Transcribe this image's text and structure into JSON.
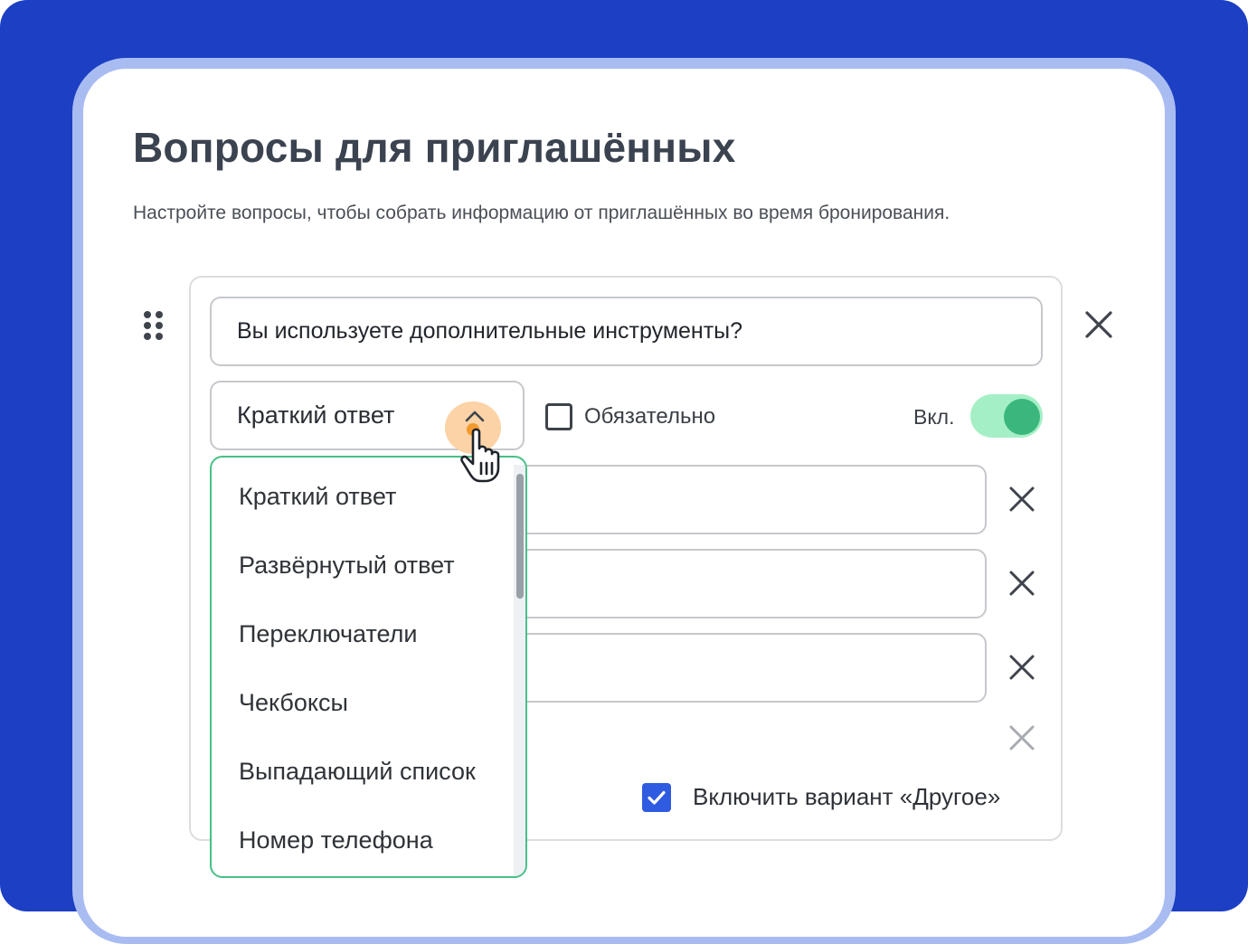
{
  "header": {
    "title": "Вопросы для приглашённых",
    "subtitle": "Настройте вопросы, чтобы собрать информацию от приглашённых во время бронирования."
  },
  "question": {
    "text": "Вы используете дополнительные инструменты?",
    "type_selected": "Краткий ответ",
    "required_label": "Обязательно",
    "required_checked": false,
    "toggle_label": "Вкл.",
    "toggle_on": true,
    "include_other_label": "Включить вариант «Другое»",
    "include_other_checked": true
  },
  "dropdown": {
    "options": [
      "Краткий ответ",
      "Развёрнутый ответ",
      "Переключатели",
      "Чекбоксы",
      "Выпадающий список",
      "Номер телефона"
    ]
  },
  "icons": {
    "drag": "drag-handle-icon",
    "close": "close-icon",
    "chevron": "chevron-up-icon",
    "cursor": "hand-pointer-icon",
    "check": "checkmark-icon"
  },
  "colors": {
    "background": "#1c3fc4",
    "accent_green": "#3bb77e",
    "toggle_track": "#a5efc7",
    "checkbox_blue": "#2f5be0",
    "highlight_orange": "#fbd3a6"
  }
}
